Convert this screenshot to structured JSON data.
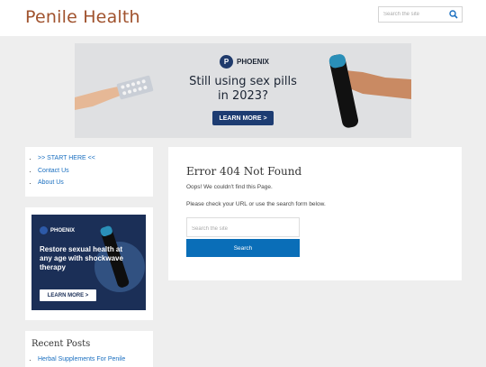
{
  "header": {
    "site_title": "Penile Health",
    "search_placeholder": "Search the site"
  },
  "banner": {
    "brand": "PHOENIX",
    "headline": "Still using sex pills in 2023?",
    "button": "LEARN MORE >"
  },
  "sidebar": {
    "nav": [
      {
        "label": ">> START HERE <<"
      },
      {
        "label": "Contact Us"
      },
      {
        "label": "About Us"
      }
    ],
    "ad": {
      "brand": "PHOENIX",
      "text": "Restore sexual health at any age with shockwave therapy",
      "button": "LEARN MORE >"
    },
    "recent": {
      "title": "Recent Posts",
      "items": [
        {
          "label": "Herbal Supplements For Penile"
        }
      ]
    }
  },
  "main": {
    "title": "Error 404 Not Found",
    "p1": "Oops! We couldn't find this Page.",
    "p2": "Please check your URL or use the search form below.",
    "search_placeholder": "Search the site",
    "search_button": "Search"
  },
  "colors": {
    "title": "#a0522d",
    "link": "#1a6fc0",
    "button": "#0a6eb8",
    "background": "#eeeeee"
  }
}
